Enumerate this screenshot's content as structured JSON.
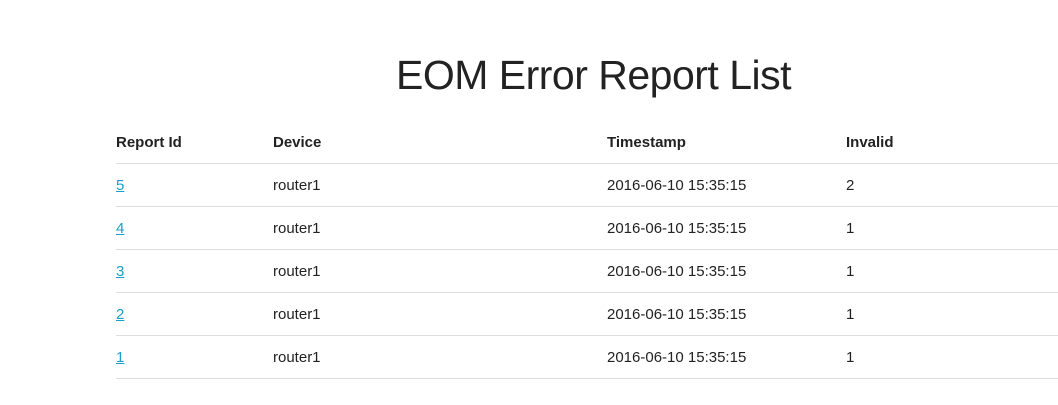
{
  "page": {
    "title": "EOM Error Report List"
  },
  "table": {
    "headers": {
      "report_id": "Report Id",
      "device": "Device",
      "timestamp": "Timestamp",
      "invalid": "Invalid"
    },
    "rows": [
      {
        "report_id": "5",
        "device": "router1",
        "timestamp": "2016-06-10 15:35:15",
        "invalid": "2"
      },
      {
        "report_id": "4",
        "device": "router1",
        "timestamp": "2016-06-10 15:35:15",
        "invalid": "1"
      },
      {
        "report_id": "3",
        "device": "router1",
        "timestamp": "2016-06-10 15:35:15",
        "invalid": "1"
      },
      {
        "report_id": "2",
        "device": "router1",
        "timestamp": "2016-06-10 15:35:15",
        "invalid": "1"
      },
      {
        "report_id": "1",
        "device": "router1",
        "timestamp": "2016-06-10 15:35:15",
        "invalid": "1"
      }
    ]
  },
  "colors": {
    "link": "#1a9fc9",
    "text": "#222222",
    "border": "#dddddd"
  }
}
